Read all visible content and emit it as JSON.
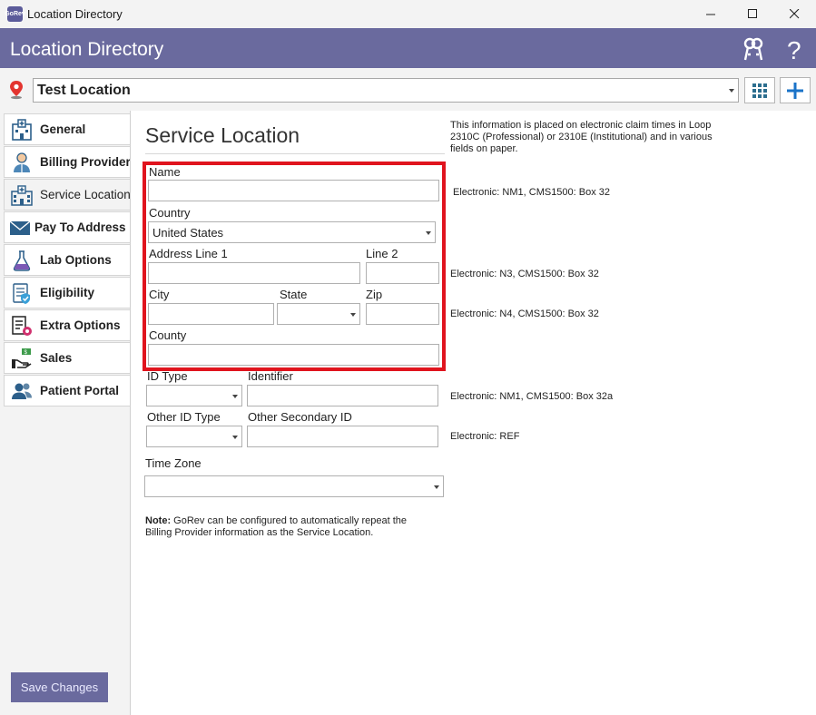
{
  "window": {
    "title": "Location Directory",
    "app_icon_text": "GoRev"
  },
  "header": {
    "title": "Location Directory"
  },
  "location_bar": {
    "selected_location": "Test Location"
  },
  "sidebar": {
    "items": [
      {
        "label": "General",
        "icon": "hospital-icon"
      },
      {
        "label": "Billing Provider",
        "icon": "doctor-icon"
      },
      {
        "label": "Service Location",
        "icon": "clinic-icon"
      },
      {
        "label": "Pay To Address",
        "icon": "envelope-icon"
      },
      {
        "label": "Lab Options",
        "icon": "flask-icon"
      },
      {
        "label": "Eligibility",
        "icon": "eligibility-icon"
      },
      {
        "label": "Extra Options",
        "icon": "options-icon"
      },
      {
        "label": "Sales",
        "icon": "sales-icon"
      },
      {
        "label": "Patient Portal",
        "icon": "users-icon"
      }
    ],
    "active": "Service Location",
    "save_label": "Save Changes"
  },
  "main": {
    "title": "Service Location",
    "info": "This information is placed on electronic claim times in Loop 2310C (Professional) or 2310E (Institutional) and in various fields on paper.",
    "fields": {
      "name": {
        "label": "Name",
        "value": ""
      },
      "country": {
        "label": "Country",
        "value": "United States"
      },
      "address1": {
        "label": "Address Line 1",
        "value": ""
      },
      "line2": {
        "label": "Line 2",
        "value": ""
      },
      "city": {
        "label": "City",
        "value": ""
      },
      "state": {
        "label": "State",
        "value": ""
      },
      "zip": {
        "label": "Zip",
        "value": ""
      },
      "county": {
        "label": "County",
        "value": ""
      },
      "id_type": {
        "label": "ID Type",
        "value": ""
      },
      "identifier": {
        "label": "Identifier",
        "value": ""
      },
      "other_id_type": {
        "label": "Other ID Type",
        "value": ""
      },
      "other_secondary_id": {
        "label": "Other Secondary ID",
        "value": ""
      },
      "time_zone": {
        "label": "Time Zone",
        "value": ""
      }
    },
    "electronic": {
      "name": "Electronic: NM1, CMS1500: Box 32",
      "address": "Electronic: N3, CMS1500: Box 32",
      "city": "Electronic: N4, CMS1500: Box 32",
      "identifier": "Electronic: NM1, CMS1500: Box 32a",
      "secondary": "Electronic: REF"
    },
    "note_bold": "Note:",
    "note_text": " GoRev can be configured to automatically repeat the Billing Provider information as the Service Location."
  },
  "colors": {
    "header": "#6a6a9e",
    "highlight_box": "#e0141e",
    "accent_blue": "#1a73c8"
  }
}
